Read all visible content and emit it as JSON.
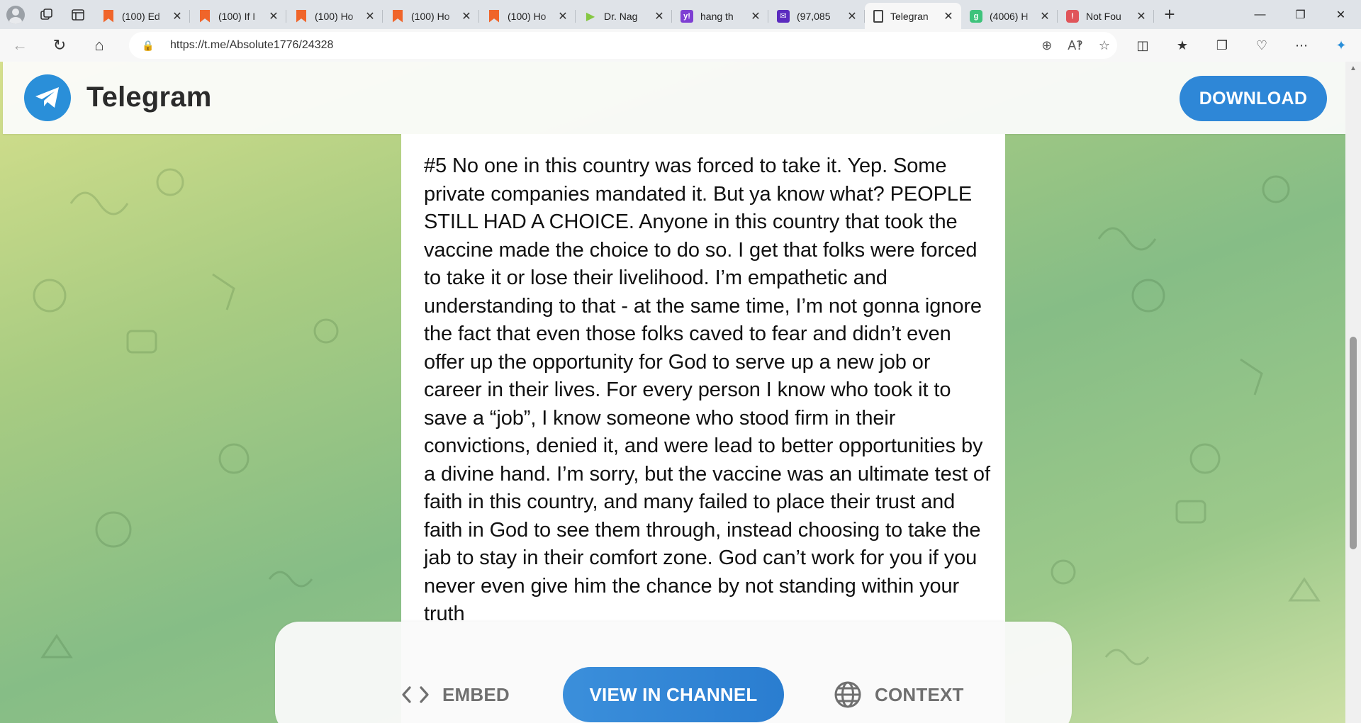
{
  "browser": {
    "tabs": [
      {
        "label": "(100) Ed",
        "favicon": "bookmark-icon",
        "active": false
      },
      {
        "label": "(100) If I",
        "favicon": "bookmark-icon",
        "active": false
      },
      {
        "label": "(100) Ho",
        "favicon": "bookmark-icon",
        "active": false
      },
      {
        "label": "(100) Ho",
        "favicon": "bookmark-icon",
        "active": false
      },
      {
        "label": "(100) Ho",
        "favicon": "bookmark-icon",
        "active": false
      },
      {
        "label": "Dr. Nag",
        "favicon": "rumble-icon",
        "active": false
      },
      {
        "label": "hang th",
        "favicon": "yahoo-icon",
        "active": false
      },
      {
        "label": "(97,085",
        "favicon": "mail-icon",
        "active": false
      },
      {
        "label": "Telegran",
        "favicon": "document-icon",
        "active": true
      },
      {
        "label": "(4006) H",
        "favicon": "gab-icon",
        "active": false
      },
      {
        "label": "Not Fou",
        "favicon": "error-icon",
        "active": false
      }
    ],
    "url": "https://t.me/Absolute1776/24328"
  },
  "telegram": {
    "brand": "Telegram",
    "download_label": "DOWNLOAD",
    "post_text": "#5 No one in this country was forced to take it. Yep. Some private companies mandated it. But ya know what? PEOPLE STILL HAD A CHOICE. Anyone in this country that took the vaccine made the choice to do so. I get that folks were forced to take it or lose their livelihood. I’m empathetic and understanding to that - at the same time, I’m not gonna ignore the fact that even those folks caved to fear and didn’t even offer up the opportunity for God to serve up a new job or career in their lives. For every person I know who took it to save a “job”, I know someone who stood firm in their convictions, denied it, and were lead to better opportunities by a divine hand. I’m sorry, but the vaccine was an ultimate test of faith in this country, and many failed to place their trust and faith in God to see them through, instead choosing to take the jab to stay in their comfort zone. God can’t work for you if you never even give him the chance by not standing within your truth",
    "footer": {
      "embed_label": "EMBED",
      "view_label": "VIEW IN CHANNEL",
      "context_label": "CONTEXT"
    },
    "colors": {
      "accent": "#2e87d7",
      "background_top": "#d6e08c",
      "background_mid": "#86bd86"
    }
  }
}
